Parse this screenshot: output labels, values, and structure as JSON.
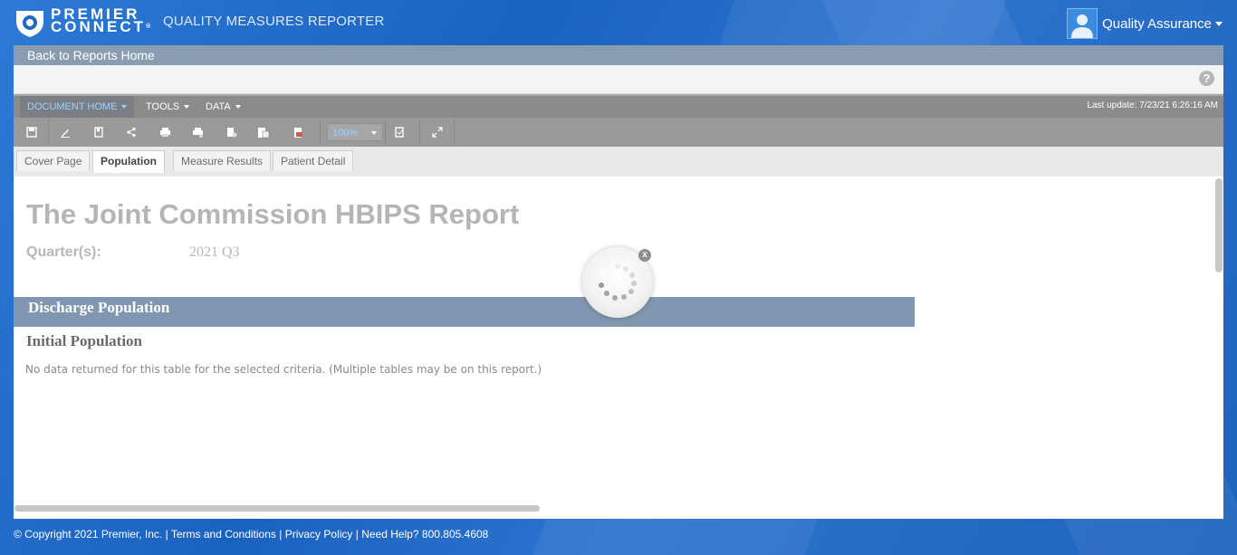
{
  "header": {
    "brand_line1": "PREMIER",
    "brand_line2": "CONNECT",
    "brand_reg": "®",
    "app_title": "QUALITY MEASURES REPORTER",
    "user_name": "Quality Assurance"
  },
  "nav": {
    "back_label": "Back to Reports Home",
    "help_label": "?"
  },
  "menu": {
    "items": [
      "DOCUMENT HOME",
      "TOOLS",
      "DATA"
    ],
    "last_update": "Last update: 7/23/21 6:26:16 AM"
  },
  "toolbar": {
    "zoom": "100%",
    "icons": [
      "save-icon",
      "edit-icon",
      "bookmark-icon",
      "share-icon",
      "print-icon",
      "print-preview-icon",
      "export-icon",
      "excel-icon",
      "pdf-icon",
      "refresh-icon",
      "fullscreen-icon"
    ]
  },
  "tabs": [
    "Cover Page",
    "Population",
    "Measure Results",
    "Patient Detail"
  ],
  "active_tab": "Population",
  "report": {
    "title": "The Joint Commission HBIPS Report",
    "quarter_label": "Quarter(s):",
    "quarter_value": "2021 Q3",
    "section_title": "Discharge Population",
    "subsection_title": "Initial Population",
    "no_data_msg": "No data returned for this table for the selected criteria. (Multiple tables may be on this report.)"
  },
  "spinner": {
    "close_label": "x"
  },
  "footer": {
    "copyright": "© Copyright 2021 Premier, Inc.",
    "sep": "|",
    "terms": "Terms and Conditions",
    "privacy": "Privacy Policy",
    "help": "Need Help? 800.805.4608"
  },
  "colors": {
    "background": "#1f68c4",
    "backbar": "#8a9db0",
    "section_bar": "#7f97b0",
    "menu_active_text": "#9fd0ff"
  }
}
